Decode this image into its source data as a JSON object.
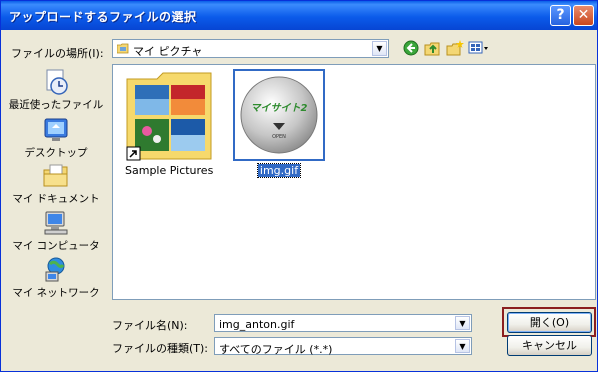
{
  "window": {
    "title": "アップロードするファイルの選択"
  },
  "title_buttons": {
    "help": "?",
    "close": "✕"
  },
  "look_in": {
    "label": "ファイルの場所(I):",
    "value": "マイ ピクチャ"
  },
  "toolbar": {
    "icons": [
      "back-icon",
      "up-folder-icon",
      "new-folder-icon",
      "views-menu-icon"
    ]
  },
  "places": [
    {
      "label": "最近使ったファイル",
      "icon": "recent-documents-icon"
    },
    {
      "label": "デスクトップ",
      "icon": "desktop-icon"
    },
    {
      "label": "マイ ドキュメント",
      "icon": "my-documents-icon"
    },
    {
      "label": "マイ コンピュータ",
      "icon": "my-computer-icon"
    },
    {
      "label": "マイ ネットワーク",
      "icon": "my-network-icon"
    }
  ],
  "files": [
    {
      "name": "Sample Pictures",
      "type": "folder-shortcut",
      "selected": false
    },
    {
      "name": "img.gif",
      "type": "image",
      "selected": true,
      "thumbnail_text": "マイサイト2",
      "thumbnail_sub": "OPEN"
    }
  ],
  "file_name": {
    "label": "ファイル名(N):",
    "value": "img_anton.gif"
  },
  "file_type": {
    "label": "ファイルの種類(T):",
    "value": "すべてのファイル (*.*)"
  },
  "buttons": {
    "open": "開く(O)",
    "cancel": "キャンセル"
  },
  "colors": {
    "titlebar": "#0a5ee8",
    "selection": "#316ac5",
    "dialog_bg": "#ece9d8",
    "highlight_ring": "#8b1f1f"
  }
}
